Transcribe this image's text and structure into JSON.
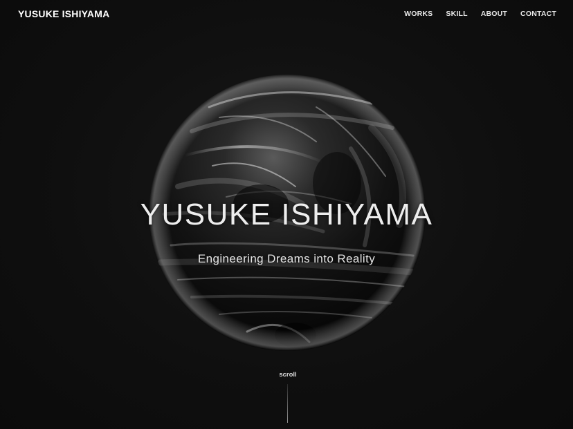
{
  "header": {
    "brand": "YUSUKE ISHIYAMA",
    "nav": [
      {
        "label": "WORKS"
      },
      {
        "label": "SKILL"
      },
      {
        "label": "ABOUT"
      },
      {
        "label": "CONTACT"
      }
    ]
  },
  "hero": {
    "title": "YUSUKE ISHIYAMA",
    "subtitle": "Engineering Dreams into Reality",
    "scroll_label": "scroll"
  },
  "colors": {
    "background": "#0e0e0e",
    "text": "#f2f2f2"
  }
}
